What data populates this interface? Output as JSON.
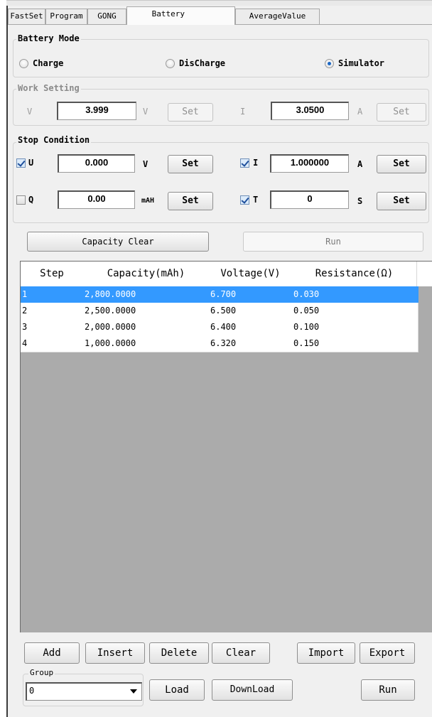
{
  "tabs": [
    "FastSet",
    "Program",
    "GONG",
    "Battery",
    "AverageValue"
  ],
  "active_tab": "Battery",
  "battery_mode": {
    "title": "Battery Mode",
    "options": [
      "Charge",
      "DisCharge",
      "Simulator"
    ],
    "selected": "Simulator"
  },
  "work_setting": {
    "title": "Work Setting",
    "v_label": "V",
    "v_value": "3.999",
    "v_unit": "V",
    "v_button": "Set",
    "i_label": "I",
    "i_value": "3.0500",
    "i_unit": "A",
    "i_button": "Set"
  },
  "stop_condition": {
    "title": "Stop Condition",
    "u": {
      "label": "U",
      "checked": true,
      "value": "0.000",
      "unit": "V",
      "button": "Set"
    },
    "i": {
      "label": "I",
      "checked": true,
      "value": "1.000000",
      "unit": "A",
      "button": "Set"
    },
    "q": {
      "label": "Q",
      "checked": false,
      "value": "0.00",
      "unit": "mAH",
      "button": "Set"
    },
    "t": {
      "label": "T",
      "checked": true,
      "value": "0",
      "unit": "S",
      "button": "Set"
    }
  },
  "actions": {
    "capacity_clear": "Capacity Clear",
    "run": "Run"
  },
  "table": {
    "columns": [
      "Step",
      "Capacity(mAh)",
      "Voltage(V)",
      "Resistance(Ω)"
    ],
    "rows": [
      [
        "1",
        "2,800.0000",
        "6.700",
        "0.030"
      ],
      [
        "2",
        "2,500.0000",
        "6.500",
        "0.050"
      ],
      [
        "3",
        "2,000.0000",
        "6.400",
        "0.100"
      ],
      [
        "4",
        "1,000.0000",
        "6.320",
        "0.150"
      ]
    ],
    "selected_row": 0
  },
  "bottom": {
    "add": "Add",
    "insert": "Insert",
    "delete": "Delete",
    "clear": "Clear",
    "import": "Import",
    "export": "Export",
    "group_title": "Group",
    "group_value": "0",
    "load": "Load",
    "download": "DownLoad",
    "run": "Run"
  },
  "colors": {
    "selection": "#3399ff",
    "radio_dot": "#1b67c4",
    "table_bg": "#ababab"
  }
}
